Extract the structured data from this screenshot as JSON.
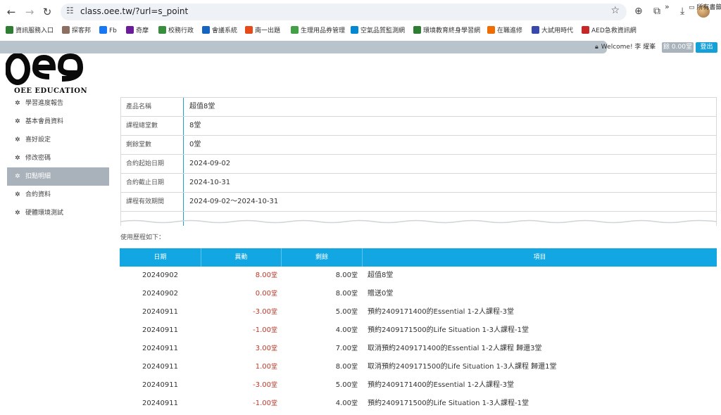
{
  "browser": {
    "url": "class.oee.tw/?url=s_point",
    "bookmarks": [
      {
        "label": "資訊服務入口",
        "color": "#2e7d32"
      },
      {
        "label": "探客邦",
        "color": "#8d6e63"
      },
      {
        "label": "Fb",
        "color": "#1877f2"
      },
      {
        "label": "奇摩",
        "color": "#6a1b9a"
      },
      {
        "label": "校務行政",
        "color": "#388e3c"
      },
      {
        "label": "會議系統",
        "color": "#1565c0"
      },
      {
        "label": "南一出題",
        "color": "#e64a19"
      },
      {
        "label": "生理用品券管理",
        "color": "#43a047"
      },
      {
        "label": "空氣品質監測網",
        "color": "#0288d1"
      },
      {
        "label": "環境教育終身學習網",
        "color": "#2e7d32"
      },
      {
        "label": "在職進修",
        "color": "#ef6c00"
      },
      {
        "label": "大試用時代",
        "color": "#3949ab"
      },
      {
        "label": "AED急救資訊網",
        "color": "#c62828"
      }
    ],
    "more": "»",
    "all_bookmarks": "所有書籤"
  },
  "header": {
    "welcome": "Welcome! 李 燿峯",
    "balance": "餘 0.00堂",
    "logout": "登出"
  },
  "logo": {
    "text": "OEE EDUCATION"
  },
  "sidebar": {
    "items": [
      {
        "label": "學習進度報告",
        "active": false
      },
      {
        "label": "基本會員資料",
        "active": false
      },
      {
        "label": "喜好設定",
        "active": false
      },
      {
        "label": "修改密碼",
        "active": false
      },
      {
        "label": "扣點明細",
        "active": true
      },
      {
        "label": "合約資料",
        "active": false
      },
      {
        "label": "硬體環境測試",
        "active": false
      }
    ]
  },
  "info": {
    "rows": [
      {
        "key": "產品名稱",
        "value": "超值8堂"
      },
      {
        "key": "課程總堂數",
        "value": "8堂"
      },
      {
        "key": "剩餘堂數",
        "value": "0堂"
      },
      {
        "key": "合約起始日期",
        "value": "2024-09-02"
      },
      {
        "key": "合約截止日期",
        "value": "2024-10-31"
      },
      {
        "key": "課程有效期間",
        "value": "2024-09-02～2024-10-31"
      }
    ]
  },
  "history": {
    "label": "使用歷程如下：",
    "headers": [
      "日期",
      "異動",
      "剩餘",
      "項目"
    ],
    "rows": [
      {
        "date": "20240902",
        "change": "8.00",
        "balance": "8.00",
        "item": "超值8堂"
      },
      {
        "date": "20240902",
        "change": "0.00",
        "balance": "8.00",
        "item": "贈送0堂"
      },
      {
        "date": "20240911",
        "change": "-3.00",
        "balance": "5.00",
        "item": "預約2409171400的Essential 1-2人課程-3堂"
      },
      {
        "date": "20240911",
        "change": "-1.00",
        "balance": "4.00",
        "item": "預約2409171500的Life Situation 1-3人課程-1堂"
      },
      {
        "date": "20240911",
        "change": "3.00",
        "balance": "7.00",
        "item": "取消預約2409171400的Essential 1-2人課程 歸還3堂"
      },
      {
        "date": "20240911",
        "change": "1.00",
        "balance": "8.00",
        "item": "取消預約2409171500的Life Situation 1-3人課程 歸還1堂"
      },
      {
        "date": "20240911",
        "change": "-3.00",
        "balance": "5.00",
        "item": "預約2409171400的Essential 1-2人課程-3堂"
      },
      {
        "date": "20240911",
        "change": "-1.00",
        "balance": "4.00",
        "item": "預約2409171500的Life Situation 1-3人課程-1堂"
      }
    ],
    "unit": "堂"
  }
}
